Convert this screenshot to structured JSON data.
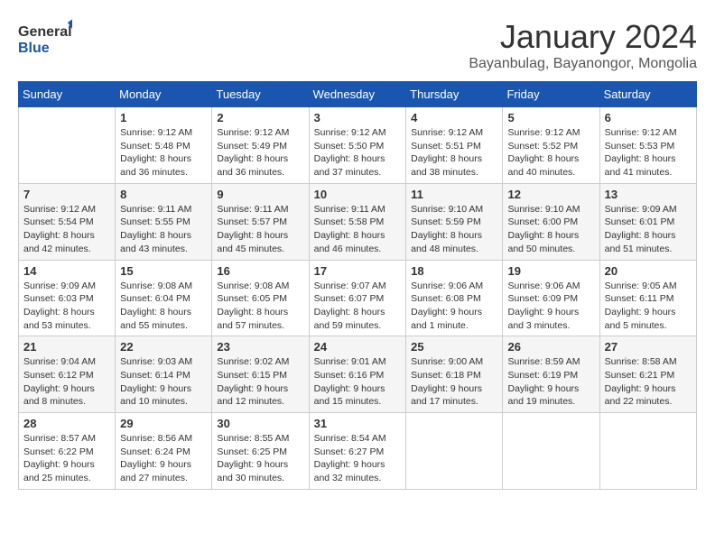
{
  "logo": {
    "line1": "General",
    "line2": "Blue"
  },
  "title": "January 2024",
  "subtitle": "Bayanbulag, Bayanongor, Mongolia",
  "days_header": [
    "Sunday",
    "Monday",
    "Tuesday",
    "Wednesday",
    "Thursday",
    "Friday",
    "Saturday"
  ],
  "weeks": [
    [
      {
        "day": "",
        "info": ""
      },
      {
        "day": "1",
        "info": "Sunrise: 9:12 AM\nSunset: 5:48 PM\nDaylight: 8 hours\nand 36 minutes."
      },
      {
        "day": "2",
        "info": "Sunrise: 9:12 AM\nSunset: 5:49 PM\nDaylight: 8 hours\nand 36 minutes."
      },
      {
        "day": "3",
        "info": "Sunrise: 9:12 AM\nSunset: 5:50 PM\nDaylight: 8 hours\nand 37 minutes."
      },
      {
        "day": "4",
        "info": "Sunrise: 9:12 AM\nSunset: 5:51 PM\nDaylight: 8 hours\nand 38 minutes."
      },
      {
        "day": "5",
        "info": "Sunrise: 9:12 AM\nSunset: 5:52 PM\nDaylight: 8 hours\nand 40 minutes."
      },
      {
        "day": "6",
        "info": "Sunrise: 9:12 AM\nSunset: 5:53 PM\nDaylight: 8 hours\nand 41 minutes."
      }
    ],
    [
      {
        "day": "7",
        "info": "Sunrise: 9:12 AM\nSunset: 5:54 PM\nDaylight: 8 hours\nand 42 minutes."
      },
      {
        "day": "8",
        "info": "Sunrise: 9:11 AM\nSunset: 5:55 PM\nDaylight: 8 hours\nand 43 minutes."
      },
      {
        "day": "9",
        "info": "Sunrise: 9:11 AM\nSunset: 5:57 PM\nDaylight: 8 hours\nand 45 minutes."
      },
      {
        "day": "10",
        "info": "Sunrise: 9:11 AM\nSunset: 5:58 PM\nDaylight: 8 hours\nand 46 minutes."
      },
      {
        "day": "11",
        "info": "Sunrise: 9:10 AM\nSunset: 5:59 PM\nDaylight: 8 hours\nand 48 minutes."
      },
      {
        "day": "12",
        "info": "Sunrise: 9:10 AM\nSunset: 6:00 PM\nDaylight: 8 hours\nand 50 minutes."
      },
      {
        "day": "13",
        "info": "Sunrise: 9:09 AM\nSunset: 6:01 PM\nDaylight: 8 hours\nand 51 minutes."
      }
    ],
    [
      {
        "day": "14",
        "info": "Sunrise: 9:09 AM\nSunset: 6:03 PM\nDaylight: 8 hours\nand 53 minutes."
      },
      {
        "day": "15",
        "info": "Sunrise: 9:08 AM\nSunset: 6:04 PM\nDaylight: 8 hours\nand 55 minutes."
      },
      {
        "day": "16",
        "info": "Sunrise: 9:08 AM\nSunset: 6:05 PM\nDaylight: 8 hours\nand 57 minutes."
      },
      {
        "day": "17",
        "info": "Sunrise: 9:07 AM\nSunset: 6:07 PM\nDaylight: 8 hours\nand 59 minutes."
      },
      {
        "day": "18",
        "info": "Sunrise: 9:06 AM\nSunset: 6:08 PM\nDaylight: 9 hours\nand 1 minute."
      },
      {
        "day": "19",
        "info": "Sunrise: 9:06 AM\nSunset: 6:09 PM\nDaylight: 9 hours\nand 3 minutes."
      },
      {
        "day": "20",
        "info": "Sunrise: 9:05 AM\nSunset: 6:11 PM\nDaylight: 9 hours\nand 5 minutes."
      }
    ],
    [
      {
        "day": "21",
        "info": "Sunrise: 9:04 AM\nSunset: 6:12 PM\nDaylight: 9 hours\nand 8 minutes."
      },
      {
        "day": "22",
        "info": "Sunrise: 9:03 AM\nSunset: 6:14 PM\nDaylight: 9 hours\nand 10 minutes."
      },
      {
        "day": "23",
        "info": "Sunrise: 9:02 AM\nSunset: 6:15 PM\nDaylight: 9 hours\nand 12 minutes."
      },
      {
        "day": "24",
        "info": "Sunrise: 9:01 AM\nSunset: 6:16 PM\nDaylight: 9 hours\nand 15 minutes."
      },
      {
        "day": "25",
        "info": "Sunrise: 9:00 AM\nSunset: 6:18 PM\nDaylight: 9 hours\nand 17 minutes."
      },
      {
        "day": "26",
        "info": "Sunrise: 8:59 AM\nSunset: 6:19 PM\nDaylight: 9 hours\nand 19 minutes."
      },
      {
        "day": "27",
        "info": "Sunrise: 8:58 AM\nSunset: 6:21 PM\nDaylight: 9 hours\nand 22 minutes."
      }
    ],
    [
      {
        "day": "28",
        "info": "Sunrise: 8:57 AM\nSunset: 6:22 PM\nDaylight: 9 hours\nand 25 minutes."
      },
      {
        "day": "29",
        "info": "Sunrise: 8:56 AM\nSunset: 6:24 PM\nDaylight: 9 hours\nand 27 minutes."
      },
      {
        "day": "30",
        "info": "Sunrise: 8:55 AM\nSunset: 6:25 PM\nDaylight: 9 hours\nand 30 minutes."
      },
      {
        "day": "31",
        "info": "Sunrise: 8:54 AM\nSunset: 6:27 PM\nDaylight: 9 hours\nand 32 minutes."
      },
      {
        "day": "",
        "info": ""
      },
      {
        "day": "",
        "info": ""
      },
      {
        "day": "",
        "info": ""
      }
    ]
  ]
}
